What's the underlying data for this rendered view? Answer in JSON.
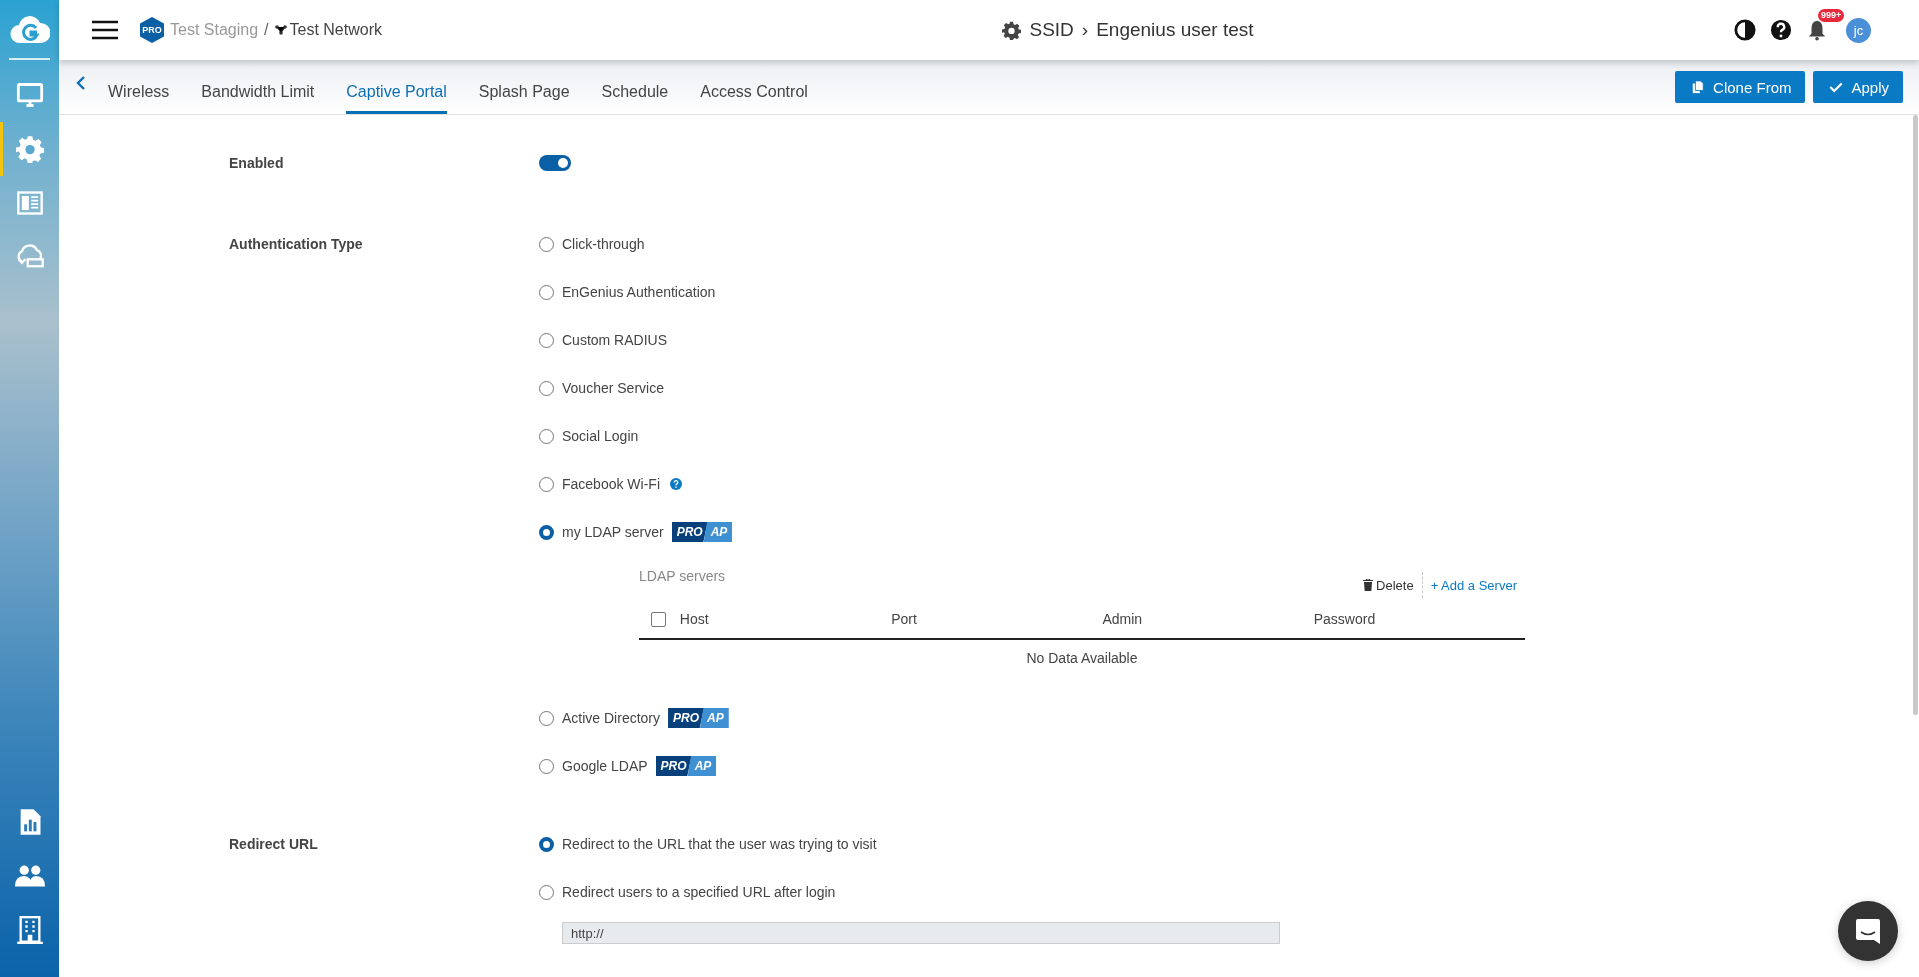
{
  "sidebar": {
    "items": [
      {
        "selected": false
      },
      {
        "selected": true
      },
      {
        "selected": false
      },
      {
        "selected": false
      }
    ],
    "bottom_items": [
      {
        "selected": false
      },
      {
        "selected": false
      },
      {
        "selected": false
      }
    ]
  },
  "header": {
    "org_badge": "PRO",
    "breadcrumb": [
      "Test Staging",
      "/",
      "Test Network"
    ],
    "title": [
      "SSID",
      "›",
      "Engenius user test"
    ],
    "notification_count": "999+",
    "avatar": "jc"
  },
  "tabs": [
    {
      "label": "Wireless",
      "selected": false
    },
    {
      "label": "Bandwidth Limit",
      "selected": false
    },
    {
      "label": "Captive Portal",
      "selected": true
    },
    {
      "label": "Splash Page",
      "selected": false
    },
    {
      "label": "Schedule",
      "selected": false
    },
    {
      "label": "Access Control",
      "selected": false
    }
  ],
  "buttons": [
    {
      "label": "Clone From",
      "kind": "clone"
    },
    {
      "label": "Apply",
      "kind": "apply"
    }
  ],
  "enabled": {
    "label": "Enabled",
    "on": true
  },
  "auth": {
    "label": "Authentication Type",
    "options": [
      {
        "label": "Click-through",
        "selected": false
      },
      {
        "label": "EnGenius Authentication",
        "selected": false
      },
      {
        "label": "Custom RADIUS",
        "selected": false
      },
      {
        "label": "Voucher Service",
        "selected": false
      },
      {
        "label": "Social Login",
        "selected": false
      },
      {
        "label": "Facebook Wi-Fi",
        "selected": false,
        "help": true
      },
      {
        "label": "my LDAP server",
        "selected": true,
        "badge": [
          "PRO",
          "AP"
        ]
      },
      {
        "label": "Active Directory",
        "selected": false,
        "badge": [
          "PRO",
          "AP"
        ]
      },
      {
        "label": "Google LDAP",
        "selected": false,
        "badge": [
          "PRO",
          "AP"
        ]
      }
    ]
  },
  "ldap": {
    "title": "LDAP servers",
    "actions": [
      "Delete",
      "+ Add a Server"
    ],
    "select_all": {
      "checked": false
    },
    "columns": [
      "Host",
      "Port",
      "Admin",
      "Password"
    ],
    "empty": "No Data Available"
  },
  "redirect": {
    "label": "Redirect URL",
    "options": [
      {
        "label": "Redirect to the URL that the user was trying to visit",
        "selected": true
      },
      {
        "label": "Redirect users to a specified URL after login",
        "selected": false
      }
    ],
    "url_field": {
      "value": "http://",
      "disabled": true
    }
  }
}
